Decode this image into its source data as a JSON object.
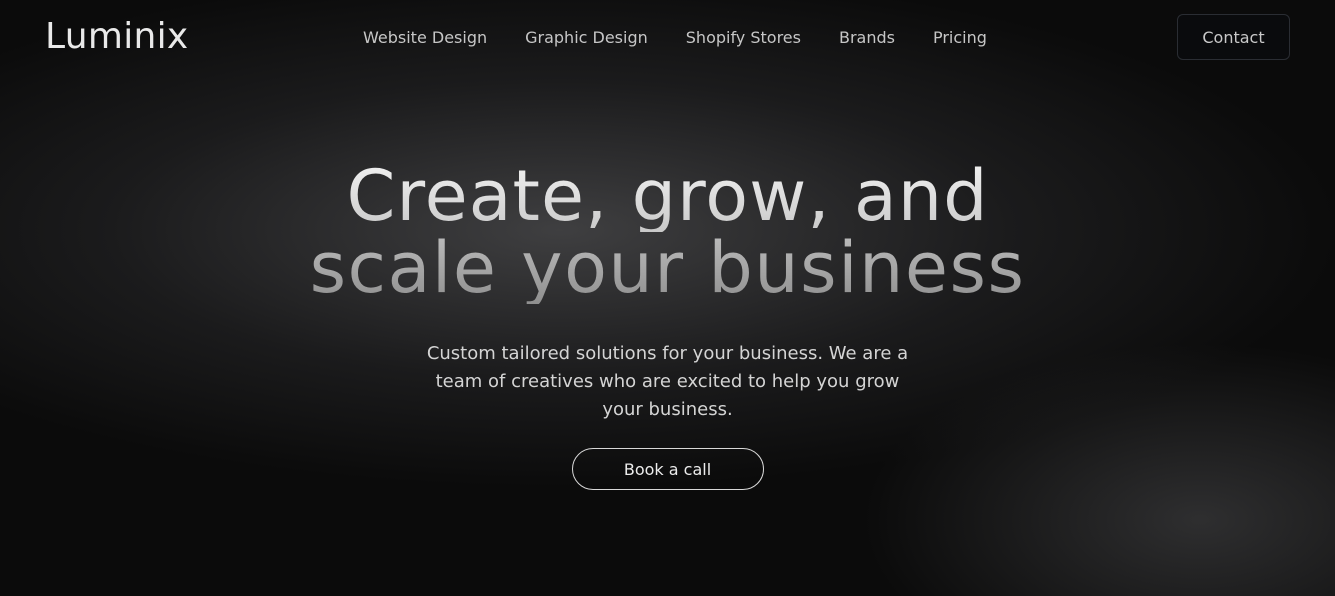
{
  "header": {
    "logo": "Luminix",
    "nav": [
      {
        "label": "Website Design"
      },
      {
        "label": "Graphic Design"
      },
      {
        "label": "Shopify Stores"
      },
      {
        "label": "Brands"
      },
      {
        "label": "Pricing"
      }
    ],
    "contact_label": "Contact"
  },
  "hero": {
    "headline_line1": "Create, grow, and",
    "headline_line2": "scale your business",
    "subtext": "Custom tailored solutions for your business. We are a team of creatives who are excited to help you grow your business.",
    "cta_label": "Book a call"
  }
}
